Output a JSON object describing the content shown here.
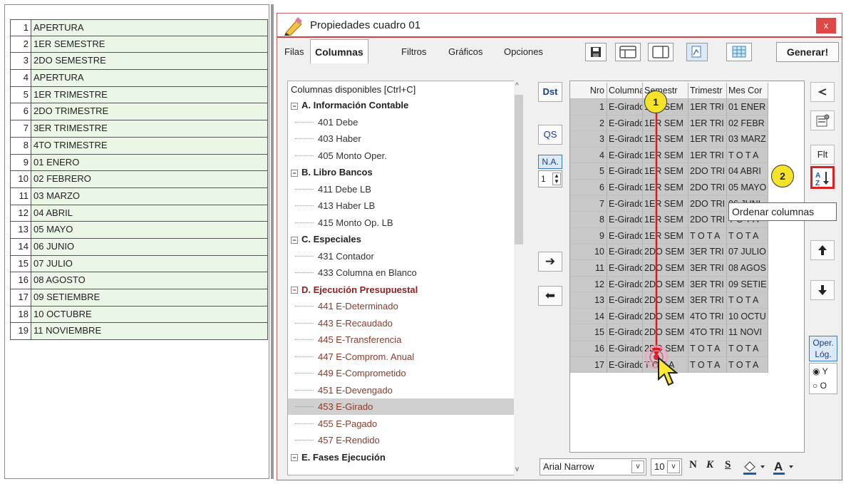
{
  "left_list": {
    "rows": [
      {
        "num": "1",
        "text": "APERTURA"
      },
      {
        "num": "2",
        "text": "1ER SEMESTRE"
      },
      {
        "num": "3",
        "text": "2DO SEMESTRE"
      },
      {
        "num": "4",
        "text": "APERTURA"
      },
      {
        "num": "5",
        "text": "1ER TRIMESTRE"
      },
      {
        "num": "6",
        "text": "2DO TRIMESTRE"
      },
      {
        "num": "7",
        "text": "3ER TRIMESTRE"
      },
      {
        "num": "8",
        "text": "4TO TRIMESTRE"
      },
      {
        "num": "9",
        "text": "01 ENERO"
      },
      {
        "num": "10",
        "text": "02 FEBRERO"
      },
      {
        "num": "11",
        "text": "03 MARZO"
      },
      {
        "num": "12",
        "text": "04 ABRIL"
      },
      {
        "num": "13",
        "text": "05 MAYO"
      },
      {
        "num": "14",
        "text": "06 JUNIO"
      },
      {
        "num": "15",
        "text": "07 JULIO"
      },
      {
        "num": "16",
        "text": "08 AGOSTO"
      },
      {
        "num": "17",
        "text": "09 SETIEMBRE"
      },
      {
        "num": "18",
        "text": "10 OCTUBRE"
      },
      {
        "num": "19",
        "text": "11 NOVIEMBRE"
      }
    ]
  },
  "dialog": {
    "title": "Propiedades cuadro 01",
    "close_label": "x",
    "tabs": [
      "Filas",
      "Columnas",
      "Filtros",
      "Gráficos",
      "Opciones"
    ],
    "generate_label": "Generar!"
  },
  "tree": {
    "header": "Columnas disponibles    [Ctrl+C]",
    "items": [
      {
        "kind": "group",
        "label": "A. Información Contable",
        "red": false
      },
      {
        "kind": "child",
        "label": "401 Debe",
        "red": false
      },
      {
        "kind": "child",
        "label": "403 Haber",
        "red": false
      },
      {
        "kind": "child",
        "label": "405 Monto Oper.",
        "red": false
      },
      {
        "kind": "group",
        "label": "B. Libro Bancos",
        "red": false
      },
      {
        "kind": "child",
        "label": "411 Debe LB",
        "red": false
      },
      {
        "kind": "child",
        "label": "413 Haber LB",
        "red": false
      },
      {
        "kind": "child",
        "label": "415 Monto Op. LB",
        "red": false
      },
      {
        "kind": "group",
        "label": "C. Especiales",
        "red": false
      },
      {
        "kind": "child",
        "label": "431 Contador",
        "red": false
      },
      {
        "kind": "child",
        "label": "433 Columna en Blanco",
        "red": false
      },
      {
        "kind": "group",
        "label": "D. Ejecución Presupuestal",
        "red": true
      },
      {
        "kind": "child",
        "label": "441 E-Determinado",
        "red": true
      },
      {
        "kind": "child",
        "label": "443 E-Recaudado",
        "red": true
      },
      {
        "kind": "child",
        "label": "445 E-Transferencia",
        "red": true
      },
      {
        "kind": "child",
        "label": "447 E-Comprom. Anual",
        "red": true
      },
      {
        "kind": "child",
        "label": "449 E-Comprometido",
        "red": true
      },
      {
        "kind": "child",
        "label": "451 E-Devengado",
        "red": true
      },
      {
        "kind": "child",
        "label": "453 E-Girado",
        "red": true,
        "selected": true
      },
      {
        "kind": "child",
        "label": "455 E-Pagado",
        "red": true
      },
      {
        "kind": "child",
        "label": "457 E-Rendido",
        "red": true
      },
      {
        "kind": "group",
        "label": "E. Fases Ejecución",
        "red": false
      }
    ]
  },
  "middle_buttons": {
    "dst": "Dst",
    "qs": "QS",
    "na": "N.A.",
    "na_value": "1",
    "right_arrow": "➔",
    "left_arrow": "⬅"
  },
  "grid": {
    "headers": [
      "Nro",
      "Columna",
      "Semestr",
      "Trimestr",
      "Mes Cor"
    ],
    "rows": [
      [
        "1",
        "E-Girado",
        "1ER SEM",
        "1ER TRI",
        "01 ENER"
      ],
      [
        "2",
        "E-Girado",
        "1ER SEM",
        "1ER TRI",
        "02 FEBR"
      ],
      [
        "3",
        "E-Girado",
        "1ER SEM",
        "1ER TRI",
        "03 MARZ"
      ],
      [
        "4",
        "E-Girado",
        "1ER SEM",
        "1ER TRI",
        "T O T A"
      ],
      [
        "5",
        "E-Girado",
        "1ER SEM",
        "2DO TRI",
        "04 ABRI"
      ],
      [
        "6",
        "E-Girado",
        "1ER SEM",
        "2DO TRI",
        "05 MAYO"
      ],
      [
        "7",
        "E-Girado",
        "1ER SEM",
        "2DO TRI",
        "06 JUNI"
      ],
      [
        "8",
        "E-Girado",
        "1ER SEM",
        "2DO TRI",
        "T O T A"
      ],
      [
        "9",
        "E-Girado",
        "1ER SEM",
        "T O T A",
        "T O T A"
      ],
      [
        "10",
        "E-Girado",
        "2DO SEM",
        "3ER TRI",
        "07 JULIO"
      ],
      [
        "11",
        "E-Girado",
        "2DO SEM",
        "3ER TRI",
        "08 AGOS"
      ],
      [
        "12",
        "E-Girado",
        "2DO SEM",
        "3ER TRI",
        "09 SETIE"
      ],
      [
        "13",
        "E-Girado",
        "2DO SEM",
        "3ER TRI",
        "T O T A"
      ],
      [
        "14",
        "E-Girado",
        "2DO SEM",
        "4TO TRI",
        "10 OCTU"
      ],
      [
        "15",
        "E-Girado",
        "2DO SEM",
        "4TO TRI",
        "11 NOVI"
      ],
      [
        "16",
        "E-Girado",
        "2DO SEM",
        "T O T A",
        "T O T A"
      ],
      [
        "17",
        "E-Girado",
        "T O T A",
        "T O T A",
        "T O T A"
      ]
    ]
  },
  "right_buttons": {
    "flt": "Flt",
    "oper_label": "Oper. Lóg.",
    "radio_y": "Y",
    "radio_o": "O"
  },
  "tooltip": "Ordenar columnas",
  "markers": [
    "1",
    "2"
  ],
  "font_bar": {
    "font": "Arial Narrow",
    "size": "10",
    "bold": "N",
    "italic": "K",
    "strike": "S"
  }
}
